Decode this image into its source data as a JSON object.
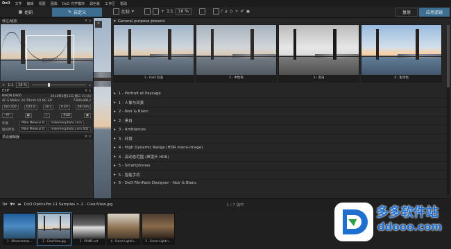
{
  "menubar": {
    "logo": "DxO",
    "items": [
      "文件",
      "编辑",
      "视图",
      "图像",
      "DxO 光学模块",
      "调色板",
      "工作区",
      "帮助"
    ]
  },
  "tabs": {
    "organize": "组织",
    "customize": "自定义",
    "compare": "比较",
    "zoom": "16 %",
    "reset": "复原",
    "apply": "应用滤镜"
  },
  "left": {
    "nav_title": "移位/缩放",
    "zoom_value": "1:1",
    "zoom_pct": "16 %",
    "exif_title": "EXIF",
    "camera": "NIKON D800",
    "date": "2014年6月11日 周三 21:03",
    "lens": "AF-S Nikkor 24-70mm f/2.8G ED",
    "dims": "7360x4912",
    "iso": "ISO 200",
    "aperture": "f/22.0",
    "shutter": "30 s",
    "ev": "0 EV",
    "focal": "48 mm",
    "mode": "- M -",
    "rgb": "RGB",
    "author_k": "作者",
    "author_v": "Mike Mewsul B",
    "author_url": "mikemeophoto.com",
    "copyright_k": "版权所有",
    "copyright_v": "Mike Mewsul B",
    "copyright_url": "mikemeophoto.com 602",
    "preset_editor": "预设编辑器"
  },
  "right": {
    "group_title": "General purpose presets",
    "thumbs": [
      "1 - DxO 标准",
      "2 - 中性色",
      "3 - 黑白",
      "4 - 生动色"
    ],
    "categories": [
      "1 - Portrait et Paysage",
      "1 - 人像与风景",
      "2 - Noir & Blanc",
      "2 - 黑白",
      "3 - Ambiances",
      "3 - 环境",
      "4 - High Dynamic Range (HDR mono-image)",
      "4 - 高动态范围 (单镜头 HDR)",
      "5 - Smartphones",
      "5 - 智能手机",
      "6 - DxO FilmPack Designer - Noir & Blanc"
    ]
  },
  "bottombar": {
    "path": "DxO OpticsPro 11 Samples > 2 - ClearView.jpg",
    "counter": "1 / 7 选中"
  },
  "filmstrip": [
    "1 - Microcontras...",
    "2 - ClearView.jpg",
    "3 - PRIME.nef",
    "4 - Smart Lightin...",
    "5 - Smart Lightin..."
  ],
  "watermark": {
    "title": "多多软件站",
    "url": "ddooo.com"
  },
  "colors": {
    "accent": "#3d6d8f",
    "watermark_green": "#2ea043",
    "watermark_blue": "#1f6fd1"
  }
}
